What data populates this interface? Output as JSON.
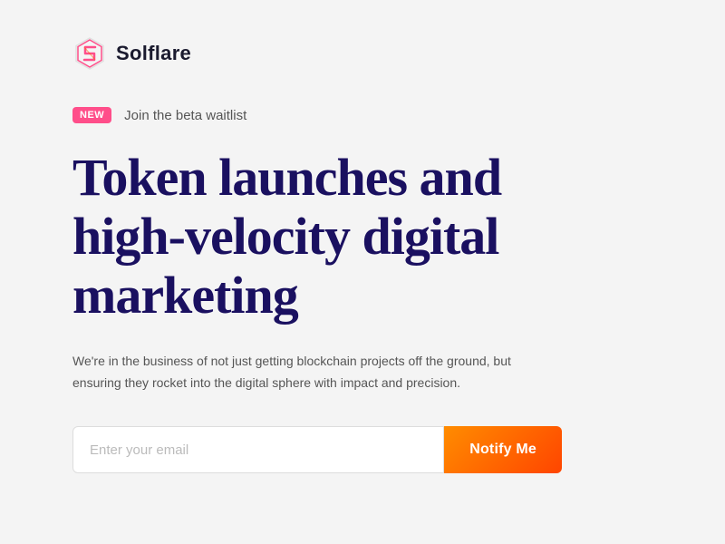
{
  "brand": {
    "name": "Solflare",
    "logo_alt": "Solflare logo"
  },
  "badge": {
    "label": "NEW",
    "text": "Join the beta waitlist"
  },
  "hero": {
    "heading": "Token launches and high-velocity digital marketing",
    "description": "We're in the business of not just getting blockchain projects off the ground,  but ensuring they rocket into the digital sphere with impact and precision."
  },
  "cta": {
    "input_placeholder": "Enter your email",
    "button_label": "Notify Me"
  },
  "colors": {
    "accent_pink": "#ff4e8a",
    "accent_orange": "#ff6a00",
    "heading_dark": "#1a1060"
  }
}
